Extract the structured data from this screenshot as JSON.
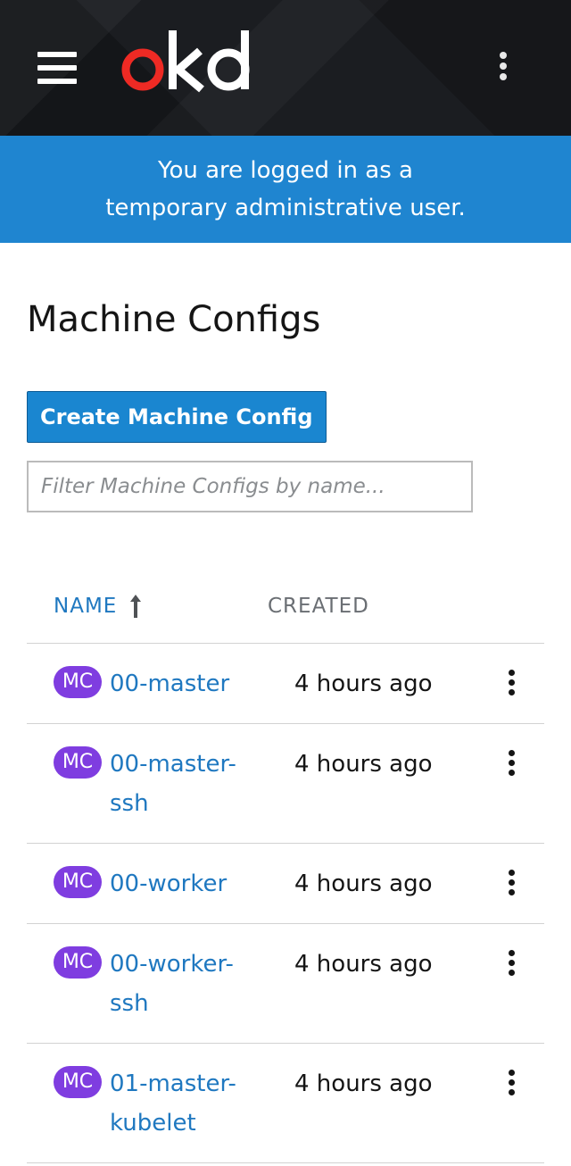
{
  "masthead": {
    "logo_text": "okd"
  },
  "banner": {
    "text": "You are logged in as a temporary administrative user."
  },
  "page": {
    "title": "Machine Configs",
    "create_button": "Create Machine Config",
    "filter_placeholder": "Filter Machine Configs by name..."
  },
  "table": {
    "columns": {
      "name": "NAME",
      "created": "CREATED"
    },
    "rows": [
      {
        "badge": "MC",
        "name": "00-master",
        "created": "4 hours ago"
      },
      {
        "badge": "MC",
        "name": "00-master-ssh",
        "created": "4 hours ago"
      },
      {
        "badge": "MC",
        "name": "00-worker",
        "created": "4 hours ago"
      },
      {
        "badge": "MC",
        "name": "00-worker-ssh",
        "created": "4 hours ago"
      },
      {
        "badge": "MC",
        "name": "01-master-kubelet",
        "created": "4 hours ago"
      }
    ]
  },
  "colors": {
    "brand_red": "#ee2a24",
    "banner_blue": "#1f85d0",
    "link_blue": "#1f78c0",
    "badge_purple": "#7f3de0"
  }
}
